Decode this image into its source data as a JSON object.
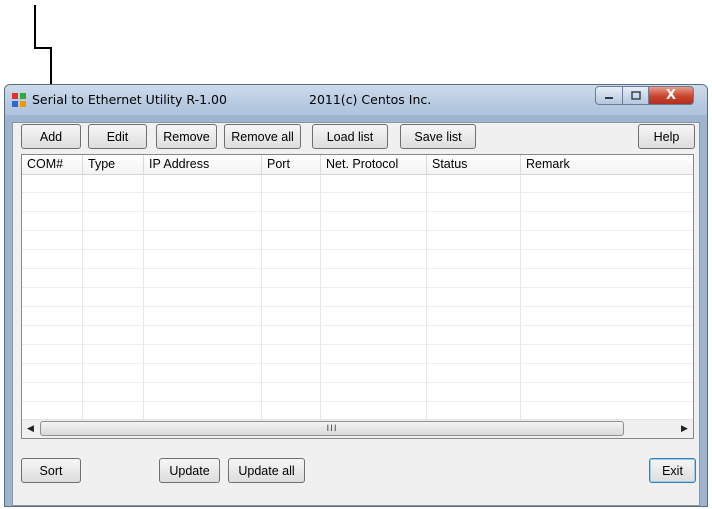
{
  "window": {
    "title": "Serial to Ethernet Utility  R-1.00",
    "copyright": "2011(c)  Centos Inc.",
    "close_glyph": "X"
  },
  "toolbar": {
    "add": "Add",
    "edit": "Edit",
    "remove": "Remove",
    "remove_all": "Remove all",
    "load_list": "Load list",
    "save_list": "Save list",
    "help": "Help"
  },
  "table": {
    "columns": [
      "COM#",
      "Type",
      "IP Address",
      "Port",
      "Net. Protocol",
      "Status",
      "Remark"
    ],
    "rows": []
  },
  "scrollbar": {
    "grip": "III"
  },
  "footer": {
    "sort": "Sort",
    "update": "Update",
    "update_all": "Update all",
    "exit": "Exit"
  },
  "icons": {
    "annotation": "arrow-down-icon",
    "app": "network-app-icon",
    "minimize": "minimize-icon",
    "maximize": "maximize-icon",
    "close": "close-icon",
    "scroll_left": "chevron-left-icon",
    "scroll_right": "chevron-right-icon"
  },
  "colors": {
    "close_button": "#c8442e",
    "titlebar": "#b9cbe2",
    "client": "#f0f0f0"
  }
}
